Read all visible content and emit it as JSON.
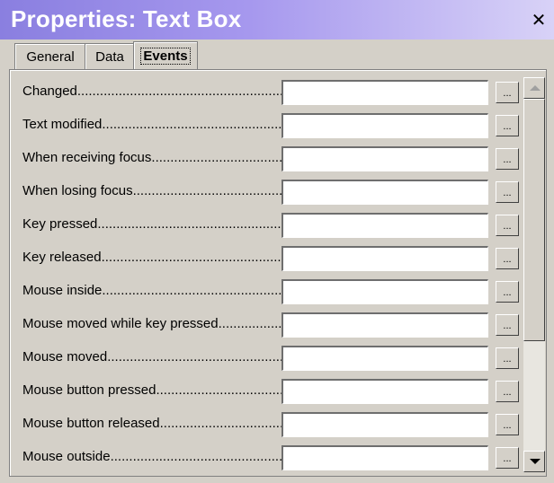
{
  "window": {
    "title": "Properties: Text Box",
    "close_symbol": "✕"
  },
  "tabs": [
    {
      "label": "General",
      "active": false
    },
    {
      "label": "Data",
      "active": false
    },
    {
      "label": "Events",
      "active": true
    }
  ],
  "events": [
    {
      "label": "Changed",
      "value": "",
      "button": "..."
    },
    {
      "label": "Text modified",
      "value": "",
      "button": "..."
    },
    {
      "label": "When receiving focus",
      "value": "",
      "button": "..."
    },
    {
      "label": "When losing focus",
      "value": "",
      "button": "..."
    },
    {
      "label": "Key pressed",
      "value": "",
      "button": "..."
    },
    {
      "label": "Key released",
      "value": "",
      "button": "..."
    },
    {
      "label": "Mouse inside",
      "value": "",
      "button": "..."
    },
    {
      "label": "Mouse moved while key pressed",
      "value": "",
      "button": "..."
    },
    {
      "label": "Mouse moved",
      "value": "",
      "button": "..."
    },
    {
      "label": "Mouse button pressed",
      "value": "",
      "button": "..."
    },
    {
      "label": "Mouse button released",
      "value": "",
      "button": "..."
    },
    {
      "label": "Mouse outside",
      "value": "",
      "button": "..."
    }
  ],
  "icons": {
    "close": "close-icon",
    "scroll_up": "scroll-up-arrow-icon",
    "scroll_down": "scroll-down-arrow-icon"
  },
  "colors": {
    "title_gradient_start": "#8a7fe0",
    "title_gradient_end": "#d8d2f7",
    "dialog_background": "#d4d0c8"
  }
}
